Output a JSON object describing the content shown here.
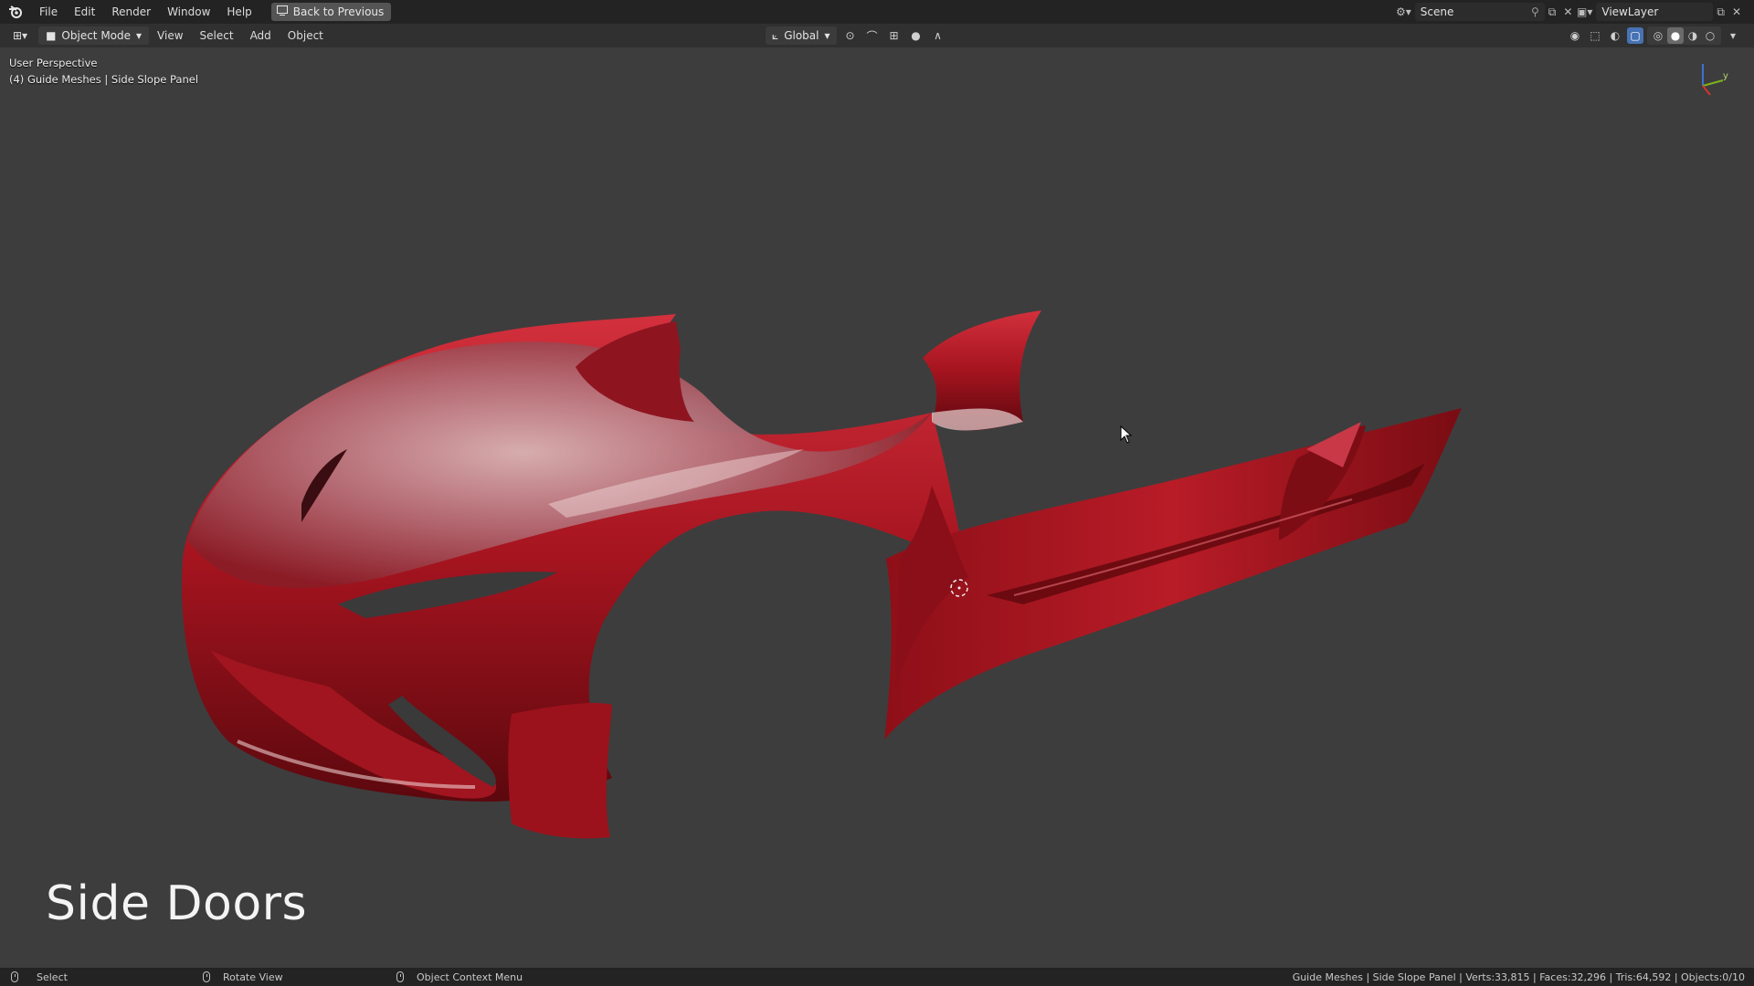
{
  "topbar": {
    "menu": [
      "File",
      "Edit",
      "Render",
      "Window",
      "Help"
    ],
    "back_button": "Back to Previous",
    "scene": "Scene",
    "view_layer": "ViewLayer"
  },
  "header": {
    "mode": "Object Mode",
    "menus": [
      "View",
      "Select",
      "Add",
      "Object"
    ],
    "transform_orientation": "Global"
  },
  "viewport": {
    "perspective": "User Perspective",
    "collection": "(4) Guide Meshes | Side Slope Panel",
    "overlay_title": "Side Doors",
    "gizmo_axis_label": "y"
  },
  "statusbar": {
    "select": "Select",
    "rotate": "Rotate View",
    "context": "Object Context Menu",
    "stats": "Guide Meshes | Side Slope Panel | Verts:33,815 | Faces:32,296 | Tris:64,592 | Objects:0/10"
  },
  "colors": {
    "accent": "#4772b3",
    "viewport_bg": "#3d3d3d",
    "mesh_red": "#b01822"
  }
}
